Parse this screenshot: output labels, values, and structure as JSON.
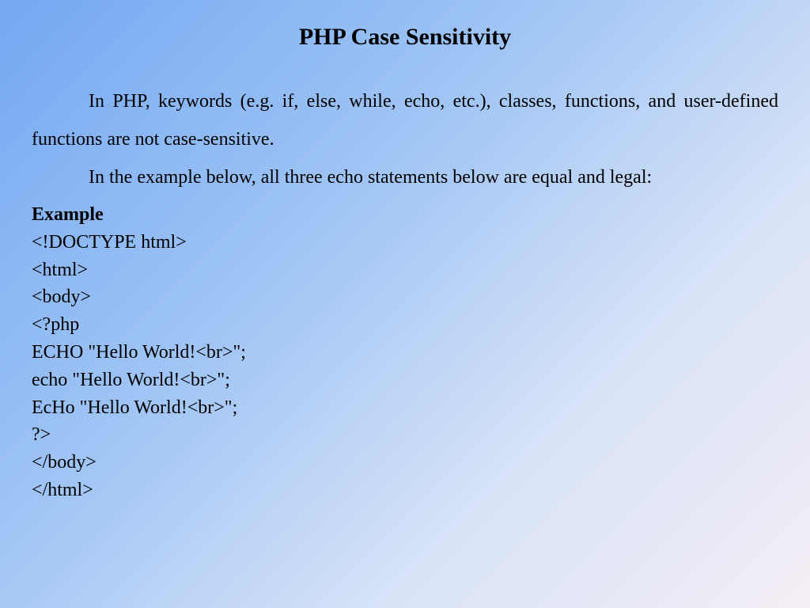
{
  "title": "PHP Case Sensitivity",
  "paragraphs": {
    "p1": "In PHP, keywords (e.g. if, else, while, echo, etc.), classes, functions, and user-defined functions are not case-sensitive.",
    "p2": "In the example below, all three echo statements below are equal and legal:"
  },
  "example": {
    "label": "Example",
    "lines": {
      "l1": "<!DOCTYPE html>",
      "l2": "<html>",
      "l3": "<body>",
      "l4": "<?php",
      "l5": "ECHO \"Hello World!<br>\";",
      "l6": "echo \"Hello World!<br>\";",
      "l7": "EcHo \"Hello World!<br>\";",
      "l8": "?>",
      "l9": "</body>",
      "l10": "</html>"
    }
  }
}
